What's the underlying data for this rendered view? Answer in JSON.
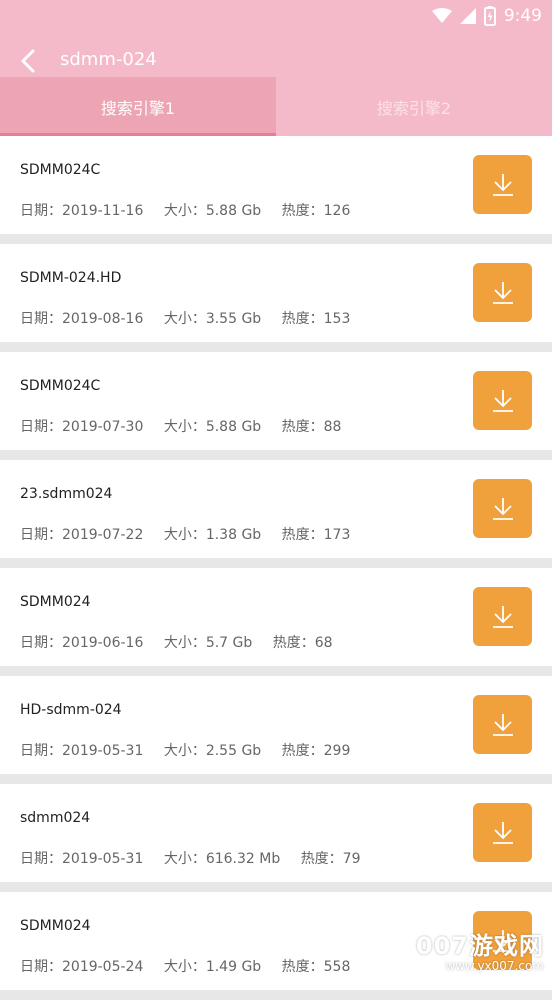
{
  "status_bar": {
    "time": "9:49",
    "icons": [
      "wifi-icon",
      "signal-icon",
      "battery-icon"
    ]
  },
  "header": {
    "title": "sdmm-024",
    "back_icon": "chevron-left-icon"
  },
  "tabs": [
    {
      "label": "搜索引擎1",
      "active": true
    },
    {
      "label": "搜索引擎2",
      "active": false
    }
  ],
  "items": [
    {
      "title": "SDMM024C",
      "date": "日期：2019-11-16",
      "size": "大小：5.88 Gb",
      "heat": "热度：126"
    },
    {
      "title": "SDMM-024.HD",
      "date": "日期：2019-08-16",
      "size": "大小：3.55 Gb",
      "heat": "热度：153"
    },
    {
      "title": "SDMM024C",
      "date": "日期：2019-07-30",
      "size": "大小：5.88 Gb",
      "heat": "热度：88"
    },
    {
      "title": "23.sdmm024",
      "date": "日期：2019-07-22",
      "size": "大小：1.38 Gb",
      "heat": "热度：173"
    },
    {
      "title": "SDMM024",
      "date": "日期：2019-06-16",
      "size": "大小：5.7 Gb",
      "heat": "热度：68"
    },
    {
      "title": "HD-sdmm-024",
      "date": "日期：2019-05-31",
      "size": "大小：2.55 Gb",
      "heat": "热度：299"
    },
    {
      "title": "sdmm024",
      "date": "日期：2019-05-31",
      "size": "大小：616.32 Mb",
      "heat": "热度：79"
    },
    {
      "title": "SDMM024",
      "date": "日期：2019-05-24",
      "size": "大小：1.49 Gb",
      "heat": "热度：558"
    }
  ],
  "watermark": {
    "main": "007游戏网",
    "sub": "www.yx007.com"
  },
  "colors": {
    "header_bg": "#f5bac9",
    "active_tab_bg": "#eda4b3",
    "tab_indicator": "#e67d9e",
    "download_button": "#f0a13c"
  }
}
